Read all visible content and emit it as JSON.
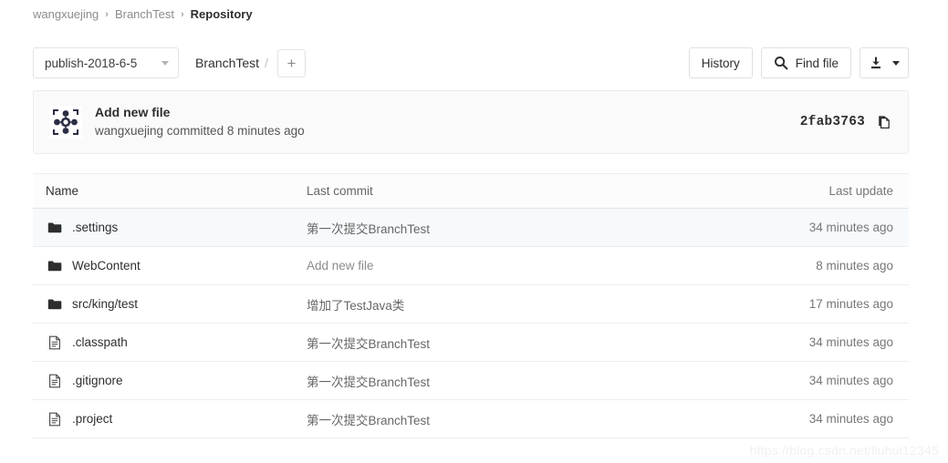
{
  "breadcrumb": {
    "separator": "›",
    "items": [
      {
        "label": "wangxuejing",
        "current": false
      },
      {
        "label": "BranchTest",
        "current": false
      },
      {
        "label": "Repository",
        "current": true
      }
    ]
  },
  "toolbar": {
    "branch_selected": "publish-2018-6-5",
    "path_label": "BranchTest",
    "path_separator": "/",
    "add_label": "+",
    "history_label": "History",
    "find_file_label": "Find file",
    "search_icon": "search-icon",
    "download_icon": "download-icon"
  },
  "commit": {
    "title": "Add new file",
    "meta": "wangxuejing committed 8 minutes ago",
    "sha": "2fab3763",
    "copy_icon": "copy-icon",
    "avatar_icon": "identicon-avatar"
  },
  "table": {
    "headers": {
      "name": "Name",
      "last_commit": "Last commit",
      "last_update": "Last update"
    },
    "rows": [
      {
        "name": ".settings",
        "type": "folder",
        "last_commit": "第一次提交BranchTest",
        "last_update": "34 minutes ago",
        "muted": false,
        "hovered": true
      },
      {
        "name": "WebContent",
        "type": "folder",
        "last_commit": "Add new file",
        "last_update": "8 minutes ago",
        "muted": true,
        "hovered": false
      },
      {
        "name": "src/king/test",
        "type": "folder",
        "last_commit": "增加了TestJava类",
        "last_update": "17 minutes ago",
        "muted": false,
        "hovered": false
      },
      {
        "name": ".classpath",
        "type": "file",
        "last_commit": "第一次提交BranchTest",
        "last_update": "34 minutes ago",
        "muted": false,
        "hovered": false
      },
      {
        "name": ".gitignore",
        "type": "file",
        "last_commit": "第一次提交BranchTest",
        "last_update": "34 minutes ago",
        "muted": false,
        "hovered": false
      },
      {
        "name": ".project",
        "type": "file",
        "last_commit": "第一次提交BranchTest",
        "last_update": "34 minutes ago",
        "muted": false,
        "hovered": false
      }
    ]
  },
  "watermark": "https://blog.csdn.net/liuhui12345",
  "colors": {
    "folder_icon": "#2e2e2e",
    "file_icon": "#4a4a4a",
    "avatar_pattern": "#2b2d44",
    "hover_row": "#f7fafc",
    "panel_bg": "#fafafa",
    "border": "#ededed"
  }
}
